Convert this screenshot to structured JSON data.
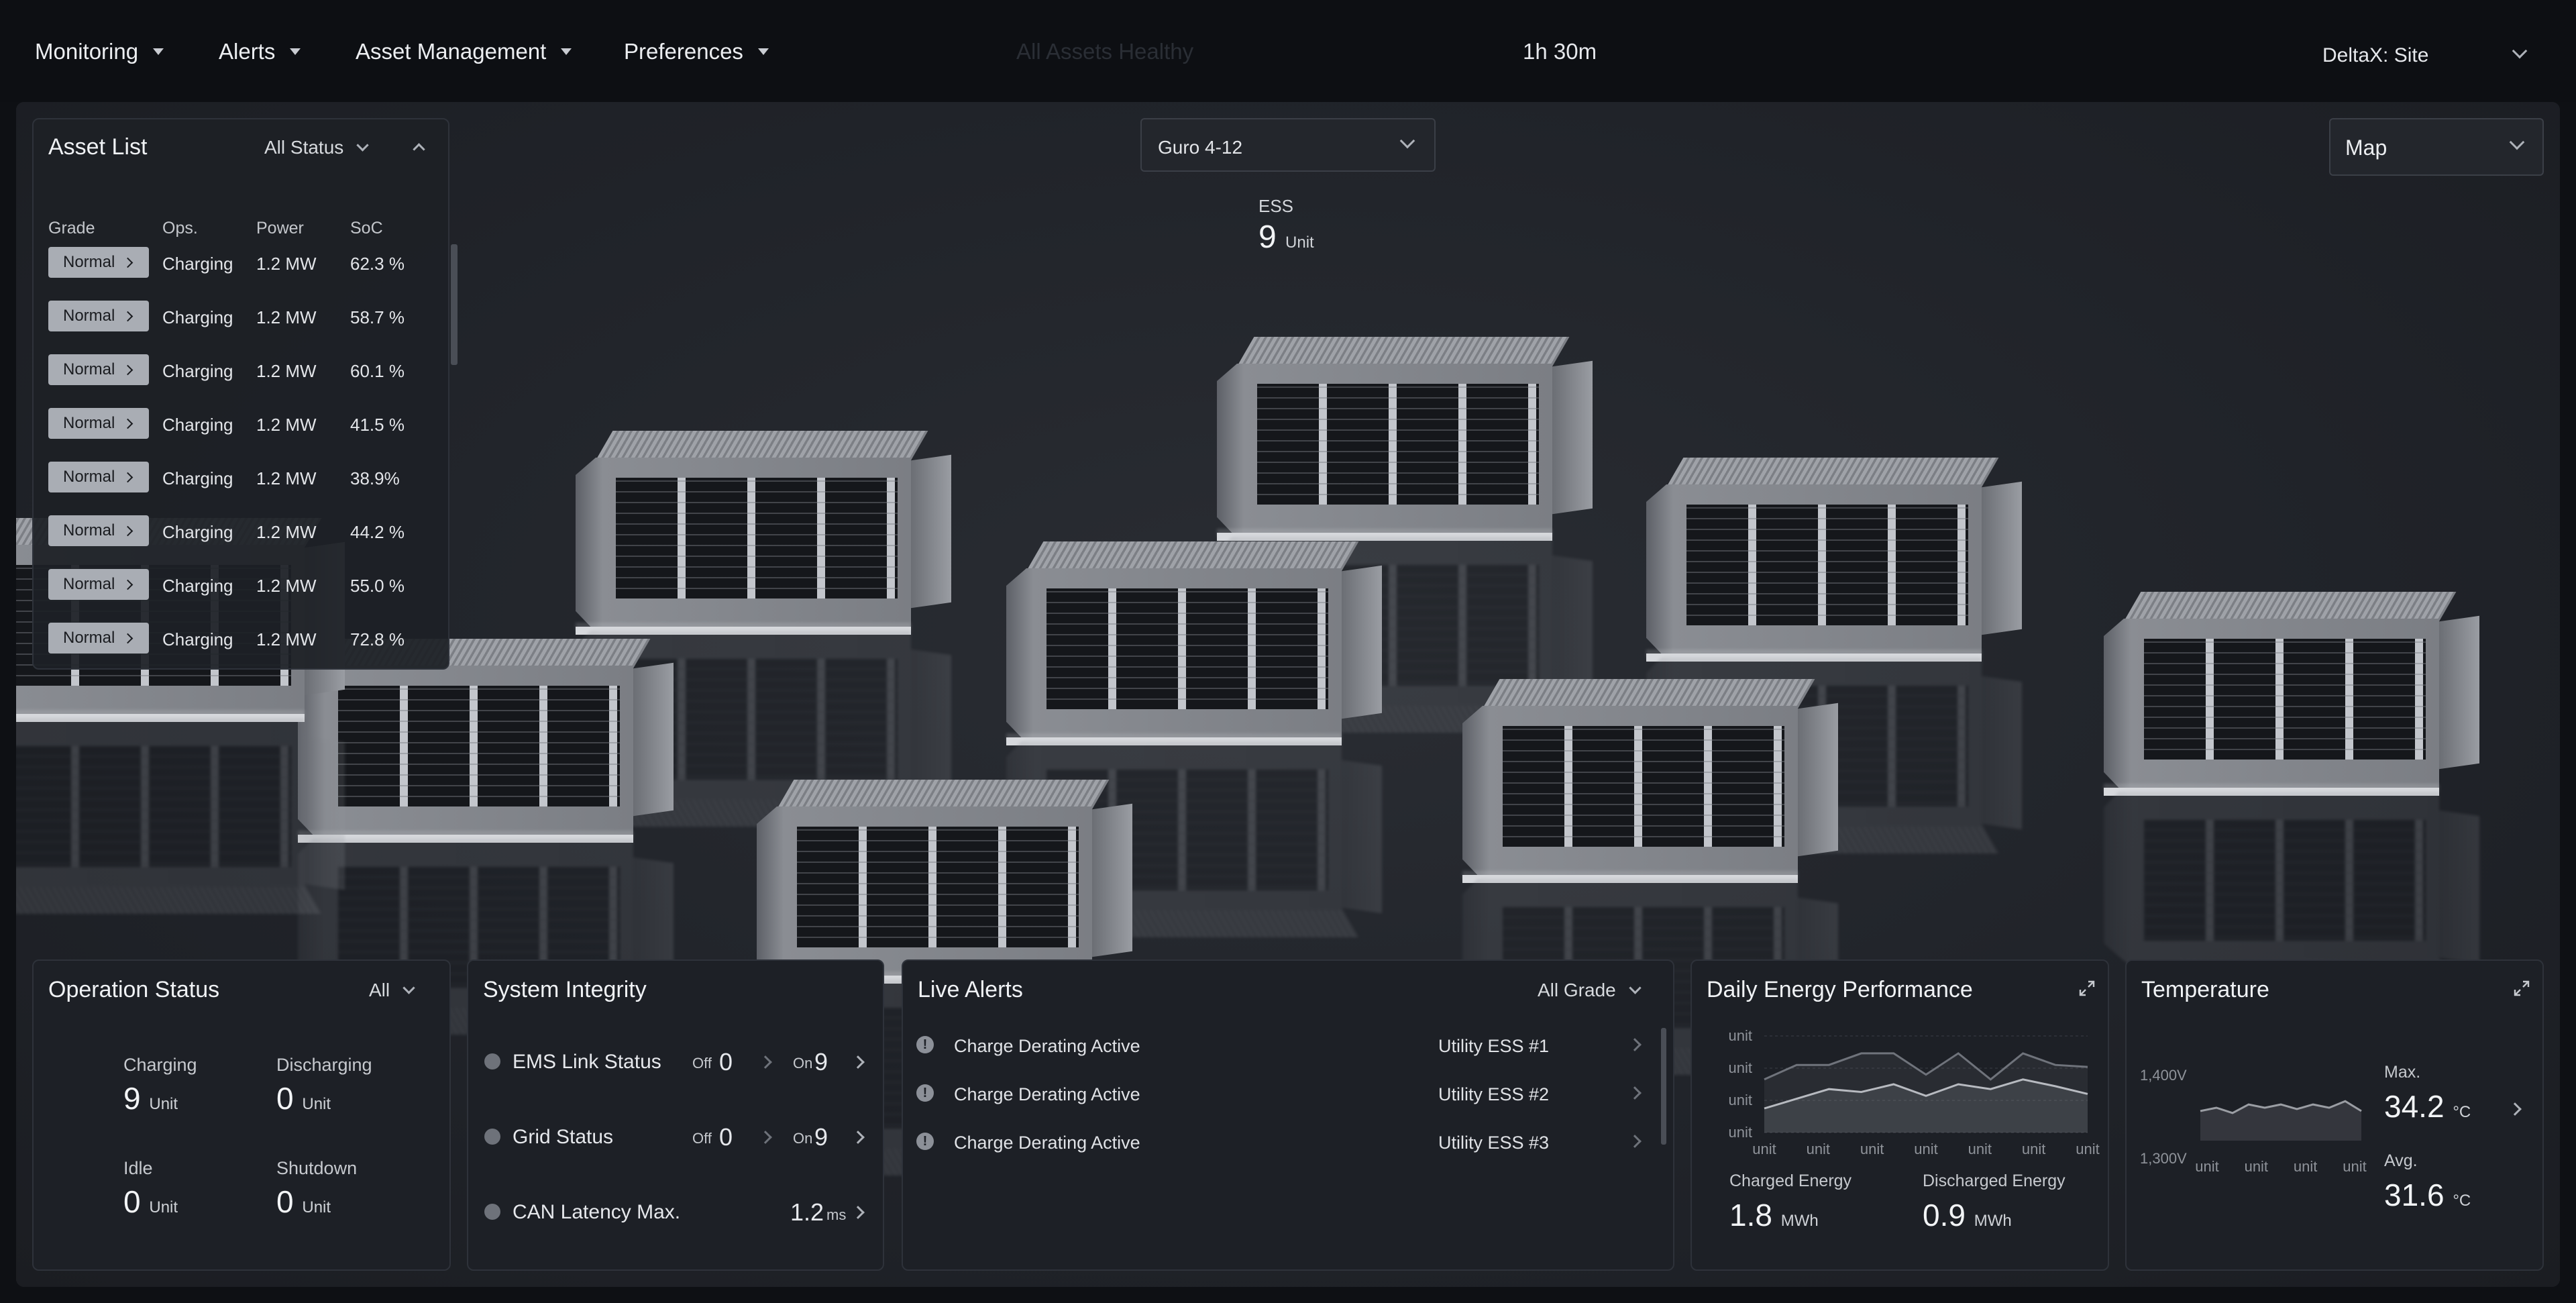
{
  "nav": {
    "items": [
      {
        "label": "Monitoring"
      },
      {
        "label": "Alerts"
      },
      {
        "label": "Asset Management"
      },
      {
        "label": "Preferences"
      }
    ],
    "health_status": "All Assets Healthy",
    "timer": "1h 30m",
    "site_selector": "DeltaX: Site"
  },
  "asset_list": {
    "title": "Asset List",
    "filter": "All Status",
    "columns": [
      "Grade",
      "Ops.",
      "Power",
      "SoC"
    ],
    "rows": [
      {
        "grade": "Normal",
        "ops": "Charging",
        "power": "1.2 MW",
        "soc": "62.3 %"
      },
      {
        "grade": "Normal",
        "ops": "Charging",
        "power": "1.2 MW",
        "soc": "58.7 %"
      },
      {
        "grade": "Normal",
        "ops": "Charging",
        "power": "1.2 MW",
        "soc": "60.1 %"
      },
      {
        "grade": "Normal",
        "ops": "Charging",
        "power": "1.2 MW",
        "soc": "41.5 %"
      },
      {
        "grade": "Normal",
        "ops": "Charging",
        "power": "1.2 MW",
        "soc": "38.9%"
      },
      {
        "grade": "Normal",
        "ops": "Charging",
        "power": "1.2 MW",
        "soc": "44.2 %"
      },
      {
        "grade": "Normal",
        "ops": "Charging",
        "power": "1.2 MW",
        "soc": "55.0 %"
      },
      {
        "grade": "Normal",
        "ops": "Charging",
        "power": "1.2 MW",
        "soc": "72.8 %"
      }
    ]
  },
  "site_view": {
    "group_selector": "Guro 4-12",
    "ess_label": "ESS",
    "ess_count": "9",
    "ess_unit": "Unit",
    "view_selector": "Map"
  },
  "operation_status": {
    "title": "Operation Status",
    "filter": "All",
    "stats": [
      {
        "label": "Charging",
        "value": "9",
        "unit": "Unit"
      },
      {
        "label": "Discharging",
        "value": "0",
        "unit": "Unit"
      },
      {
        "label": "Idle",
        "value": "0",
        "unit": "Unit"
      },
      {
        "label": "Shutdown",
        "value": "0",
        "unit": "Unit"
      }
    ]
  },
  "system_integrity": {
    "title": "System Integrity",
    "rows": [
      {
        "label": "EMS Link Status",
        "off_label": "Off",
        "off_value": "0",
        "on_label": "On",
        "on_value": "9"
      },
      {
        "label": "Grid Status",
        "off_label": "Off",
        "off_value": "0",
        "on_label": "On",
        "on_value": "9"
      },
      {
        "label": "CAN Latency Max.",
        "value": "1.2",
        "unit": "ms"
      }
    ]
  },
  "live_alerts": {
    "title": "Live Alerts",
    "filter": "All Grade",
    "items": [
      {
        "message": "Charge Derating Active",
        "asset": "Utility ESS #1"
      },
      {
        "message": "Charge Derating Active",
        "asset": "Utility ESS #2"
      },
      {
        "message": "Charge Derating Active",
        "asset": "Utility ESS #3"
      }
    ]
  },
  "daily_energy": {
    "title": "Daily Energy Performance",
    "y_ticks": [
      "unit",
      "unit",
      "unit",
      "unit"
    ],
    "x_ticks": [
      "unit",
      "unit",
      "unit",
      "unit",
      "unit",
      "unit",
      "unit"
    ],
    "charged_label": "Charged Energy",
    "charged_value": "1.8",
    "charged_unit": "MWh",
    "discharged_label": "Discharged Energy",
    "discharged_value": "0.9",
    "discharged_unit": "MWh",
    "series_upper": [
      0.55,
      0.7,
      0.7,
      0.82,
      0.82,
      0.6,
      0.82,
      0.55,
      0.82,
      0.7,
      0.68
    ],
    "series_lower": [
      0.25,
      0.35,
      0.45,
      0.42,
      0.5,
      0.38,
      0.5,
      0.45,
      0.55,
      0.48,
      0.4
    ]
  },
  "temperature": {
    "title": "Temperature",
    "y_ticks": [
      "1,400V",
      "1,300V"
    ],
    "x_ticks": [
      "unit",
      "unit",
      "unit",
      "unit"
    ],
    "max_label": "Max.",
    "max_value": "34.2",
    "avg_label": "Avg.",
    "avg_value": "31.6",
    "unit": "°C",
    "series": [
      0.45,
      0.5,
      0.42,
      0.55,
      0.5,
      0.55,
      0.48,
      0.55,
      0.5,
      0.6,
      0.45
    ]
  },
  "colors": {
    "background": "#0e1014",
    "panel": "#1d2026",
    "badge": "#a9adb4",
    "text": "#e6e8ec"
  }
}
